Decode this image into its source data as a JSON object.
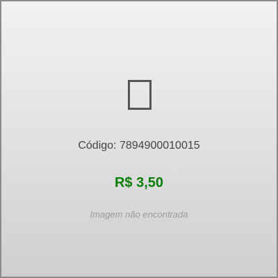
{
  "product_card": {
    "image_icon": "image-placeholder-icon",
    "code_label": "Código:",
    "code_value": "7894900010015",
    "price": "R$ 3,50",
    "image_status": "Imagem não encontrada"
  },
  "colors": {
    "price": "#0a7d0a",
    "code_text": "#444444",
    "note_text": "#9a9a9a",
    "border": "#8a8a8a"
  }
}
